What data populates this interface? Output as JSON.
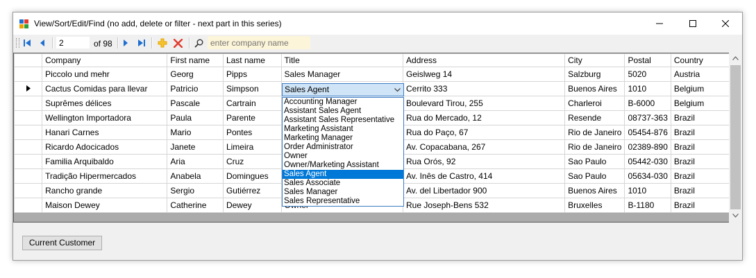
{
  "window": {
    "title": "View/Sort/Edit/Find  (no add, delete or filter - next part in this series)"
  },
  "toolbar": {
    "position_value": "2",
    "of_label": "of 98",
    "search_placeholder": "enter company name"
  },
  "grid": {
    "columns": [
      "Company",
      "First name",
      "Last name",
      "Title",
      "Address",
      "City",
      "Postal",
      "Country"
    ],
    "current_row_index": 1,
    "rows": [
      {
        "company": "Piccolo und mehr",
        "first": "Georg",
        "last": "Pipps",
        "title": "Sales Manager",
        "address": "Geislweg 14",
        "city": "Salzburg",
        "postal": "5020",
        "country": "Austria"
      },
      {
        "company": "Cactus Comidas para llevar",
        "first": "Patricio",
        "last": "Simpson",
        "title": "Sales Agent",
        "address": "Cerrito 333",
        "city": "Buenos Aires",
        "postal": "1010",
        "country": "Belgium"
      },
      {
        "company": "Suprêmes délices",
        "first": "Pascale",
        "last": "Cartrain",
        "title": "",
        "address": "Boulevard Tirou, 255",
        "city": "Charleroi",
        "postal": "B-6000",
        "country": "Belgium"
      },
      {
        "company": "Wellington Importadora",
        "first": "Paula",
        "last": "Parente",
        "title": "",
        "address": "Rua do Mercado, 12",
        "city": "Resende",
        "postal": "08737-363",
        "country": "Brazil"
      },
      {
        "company": "Hanari Carnes",
        "first": "Mario",
        "last": "Pontes",
        "title": "",
        "address": "Rua do Paço, 67",
        "city": "Rio de Janeiro",
        "postal": "05454-876",
        "country": "Brazil"
      },
      {
        "company": "Ricardo Adocicados",
        "first": "Janete",
        "last": "Limeira",
        "title": "",
        "address": "Av. Copacabana, 267",
        "city": "Rio de Janeiro",
        "postal": "02389-890",
        "country": "Brazil"
      },
      {
        "company": "Familia Arquibaldo",
        "first": "Aria",
        "last": "Cruz",
        "title": "",
        "address": "Rua Orós, 92",
        "city": "Sao Paulo",
        "postal": "05442-030",
        "country": "Brazil"
      },
      {
        "company": "Tradição Hipermercados",
        "first": "Anabela",
        "last": "Domingues",
        "title": "",
        "address": "Av. Inês de Castro, 414",
        "city": "Sao Paulo",
        "postal": "05634-030",
        "country": "Brazil"
      },
      {
        "company": "Rancho grande",
        "first": "Sergio",
        "last": "Gutiérrez",
        "title": "",
        "address": "Av. del Libertador 900",
        "city": "Buenos Aires",
        "postal": "1010",
        "country": "Brazil"
      },
      {
        "company": "Maison Dewey",
        "first": "Catherine",
        "last": "Dewey",
        "title": "Owner",
        "address": "Rue Joseph-Bens 532",
        "city": "Bruxelles",
        "postal": "B-1180",
        "country": "Brazil"
      }
    ]
  },
  "title_combo": {
    "value": "Sales Agent",
    "options": [
      "Accounting Manager",
      "Assistant Sales Agent",
      "Assistant Sales Representative",
      "Marketing Assistant",
      "Marketing Manager",
      "Order Administrator",
      "Owner",
      "Owner/Marketing Assistant",
      "Sales Agent",
      "Sales Associate",
      "Sales Manager",
      "Sales Representative"
    ],
    "selected_index": 8
  },
  "buttons": {
    "current_customer": "Current Customer"
  },
  "colors": {
    "selection": "#0078d7",
    "combo_background": "#cfe4f7",
    "search_background": "#fdf5d9",
    "delete_icon": "#e23b2e",
    "add_icon": "#e8a400",
    "nav_icon": "#1e6fd0"
  }
}
